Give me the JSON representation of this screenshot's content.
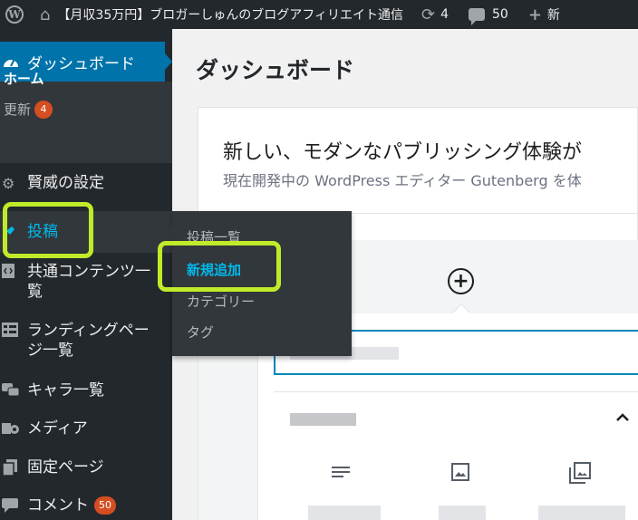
{
  "adminbar": {
    "site_title": "【月収35万円】ブロガーしゅんのブログアフィリエイト通信",
    "updates_count": "4",
    "comments_count": "50",
    "new_label": "新"
  },
  "sidebar": {
    "dashboard_label": "ダッシュボード",
    "home_label": "ホーム",
    "update_label": "更新",
    "update_badge": "4",
    "items": [
      {
        "label": "賢威の設定"
      },
      {
        "label": "投稿"
      },
      {
        "label": "共通コンテンツ一覧"
      },
      {
        "label": "ランディングページ一覧"
      },
      {
        "label": "キャラ一覧"
      },
      {
        "label": "メディア"
      },
      {
        "label": "固定ページ"
      },
      {
        "label": "コメント",
        "badge": "50"
      }
    ]
  },
  "flyout": {
    "items": [
      {
        "label": "投稿一覧"
      },
      {
        "label": "新規追加"
      },
      {
        "label": "カテゴリー"
      },
      {
        "label": "タグ"
      }
    ]
  },
  "main": {
    "page_title": "ダッシュボード",
    "panel": {
      "title": "新しい、モダンなパブリッシング体験が",
      "subtitle": "現在開発中の WordPress エディター Gutenberg を体"
    }
  },
  "colors": {
    "adminbar_bg": "#23282d",
    "menu_active": "#0073aa",
    "highlight_annotation": "#bfeb2a",
    "submenu_current": "#00b9eb"
  }
}
